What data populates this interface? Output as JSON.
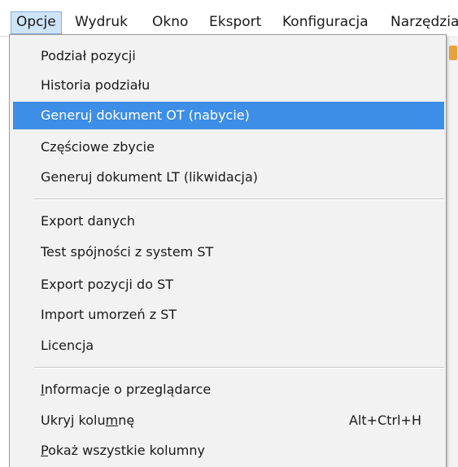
{
  "menubar": {
    "items": [
      {
        "label": "Opcje"
      },
      {
        "label": "Wydruk"
      },
      {
        "label": "Okno"
      },
      {
        "label": "Eksport"
      },
      {
        "label": "Konfiguracja"
      },
      {
        "label": "Narzędzia"
      }
    ]
  },
  "dropdown": {
    "group1": [
      {
        "label": "Podział pozycji"
      },
      {
        "label": "Historia podziału"
      },
      {
        "label": "Generuj dokument OT (nabycie)"
      },
      {
        "label": "Częściowe zbycie"
      },
      {
        "label": "Generuj dokument LT (likwidacja)"
      }
    ],
    "group2": [
      {
        "label": "Export danych"
      },
      {
        "label": "Test spójności z system ST"
      },
      {
        "label": "Export pozycji do ST"
      },
      {
        "label": "Import umorzeń z ST"
      },
      {
        "label": "Licencja"
      }
    ],
    "group3": {
      "info": {
        "mnemonic": "I",
        "rest": "nformacje o przeglądarce"
      },
      "hide": {
        "pre": "Ukryj kolu",
        "mnemonic": "m",
        "post": "nę",
        "shortcut": "Alt+Ctrl+H"
      },
      "show_all": {
        "mnemonic": "P",
        "rest": "okaż wszystkie kolumny"
      }
    }
  },
  "colors": {
    "highlight": "#3d8ee6",
    "active_menu_bg": "#cfe4f7",
    "menu_bg": "#f2f2f2"
  }
}
